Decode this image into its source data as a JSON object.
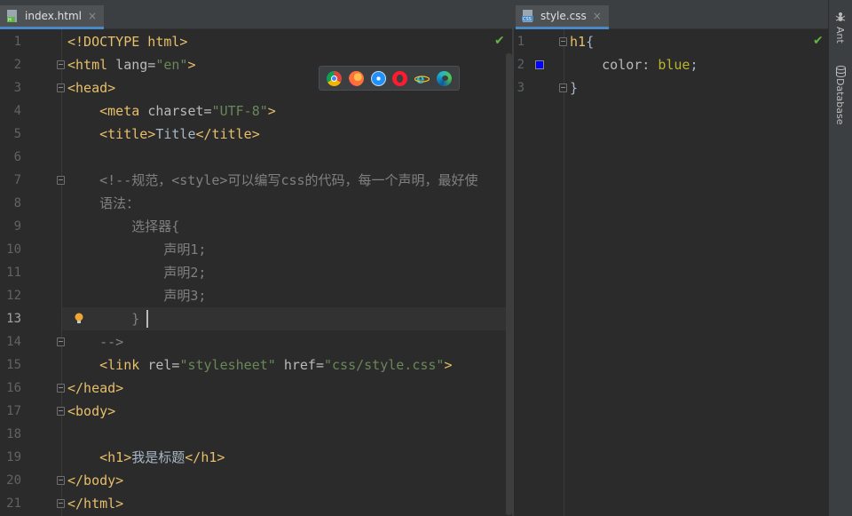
{
  "left_editor": {
    "tab": {
      "filename": "index.html",
      "icon": "html-file-icon",
      "close": "×"
    },
    "current_line": 13,
    "line_numbers": [
      "1",
      "2",
      "3",
      "4",
      "5",
      "6",
      "7",
      "8",
      "9",
      "10",
      "11",
      "12",
      "13",
      "14",
      "15",
      "16",
      "17",
      "18",
      "19",
      "20",
      "21"
    ],
    "lines": [
      [
        [
          "tag",
          "<!DOCTYPE html>"
        ]
      ],
      [
        [
          "tag",
          "<html "
        ],
        [
          "attr",
          "lang="
        ],
        [
          "val",
          "\"en\""
        ],
        [
          "tag",
          ">"
        ]
      ],
      [
        [
          "tag",
          "<head>"
        ]
      ],
      [
        [
          "txt",
          "    "
        ],
        [
          "tag",
          "<meta "
        ],
        [
          "attr",
          "charset="
        ],
        [
          "val",
          "\"UTF-8\""
        ],
        [
          "tag",
          ">"
        ]
      ],
      [
        [
          "txt",
          "    "
        ],
        [
          "tag",
          "<title>"
        ],
        [
          "txt",
          "Title"
        ],
        [
          "tag",
          "</title>"
        ]
      ],
      [],
      [
        [
          "cmt",
          "    <!--规范，<style>可以编写css的代码，每一个声明，最好使"
        ]
      ],
      [
        [
          "cmt",
          "    语法："
        ]
      ],
      [
        [
          "cmt",
          "        选择器{"
        ]
      ],
      [
        [
          "cmt",
          "            声明1;"
        ]
      ],
      [
        [
          "cmt",
          "            声明2;"
        ]
      ],
      [
        [
          "cmt",
          "            声明3;"
        ]
      ],
      [
        [
          "cmt",
          "        }"
        ]
      ],
      [
        [
          "cmt",
          "    -->"
        ]
      ],
      [
        [
          "txt",
          "    "
        ],
        [
          "tag",
          "<link "
        ],
        [
          "attr",
          "rel="
        ],
        [
          "val",
          "\"stylesheet\" "
        ],
        [
          "attr",
          "href="
        ],
        [
          "val",
          "\"css/style.css\""
        ],
        [
          "tag",
          ">"
        ]
      ],
      [
        [
          "tag",
          "</head>"
        ]
      ],
      [
        [
          "tag",
          "<body>"
        ]
      ],
      [],
      [
        [
          "txt",
          "    "
        ],
        [
          "tag",
          "<h1>"
        ],
        [
          "txt",
          "我是标题"
        ],
        [
          "tag",
          "</h1>"
        ]
      ],
      [
        [
          "tag",
          "</body>"
        ]
      ],
      [
        [
          "tag",
          "</html>"
        ]
      ]
    ],
    "browser_icons": [
      "chrome-icon",
      "firefox-icon",
      "safari-icon",
      "opera-icon",
      "ie-icon",
      "edge-icon"
    ]
  },
  "right_editor": {
    "tab": {
      "filename": "style.css",
      "icon": "css-file-icon",
      "close": "×"
    },
    "line_numbers": [
      "1",
      "2",
      "3"
    ],
    "lines": [
      [
        [
          "sel",
          "h1"
        ],
        [
          "txt",
          "{"
        ]
      ],
      [
        [
          "txt",
          "    "
        ],
        [
          "prop",
          "color"
        ],
        [
          "txt",
          ": "
        ],
        [
          "cssval",
          "blue"
        ],
        [
          "txt",
          ";"
        ]
      ],
      [
        [
          "txt",
          "}"
        ]
      ]
    ],
    "swatch_color": "#0000ff"
  },
  "tool_windows": [
    {
      "label": "Ant",
      "icon": "ant-icon"
    },
    {
      "label": "Database",
      "icon": "database-icon"
    }
  ],
  "colors": {
    "tag": "#e8bf6a",
    "attr": "#bababa",
    "string": "#6a8759",
    "comment": "#808080",
    "text": "#a9b7c6",
    "css_value": "#bbb529",
    "accent": "#4a88c7"
  }
}
